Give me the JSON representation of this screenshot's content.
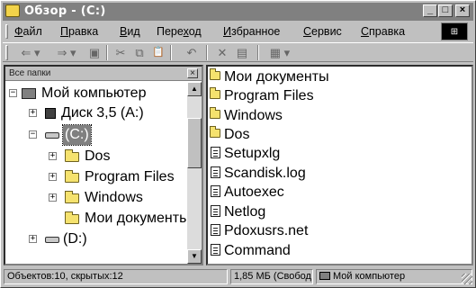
{
  "window": {
    "title": "Обзор - (C:)"
  },
  "title_buttons": {
    "minimize": "_",
    "maximize": "□",
    "close": "×"
  },
  "menu": [
    "Файл",
    "Правка",
    "Вид",
    "Переход",
    "Избранное",
    "Сервис",
    "Справка"
  ],
  "menu_accel": [
    "Ф",
    "П",
    "В",
    "х",
    "И",
    "С",
    "С"
  ],
  "toolbar": {
    "back": "⇐ ▾",
    "forward": "⇒ ▾",
    "up": "▣",
    "cut": "✂",
    "copy": "⧉",
    "paste": "📋",
    "undo": "↶",
    "delete": "✕",
    "properties": "▤",
    "views": "▦ ▾"
  },
  "left_pane": {
    "header": "Все папки",
    "close": "×",
    "tree": [
      {
        "label": "Мой компьютер",
        "icon": "computer-icon",
        "expander": "−"
      },
      {
        "label": "Диск 3,5 (A:)",
        "icon": "floppy-icon",
        "expander": "+"
      },
      {
        "label": "(C:)",
        "icon": "drive-icon",
        "expander": "−",
        "selected": true
      },
      {
        "label": "Dos",
        "icon": "folder-icon",
        "expander": "+"
      },
      {
        "label": "Program Files",
        "icon": "folder-icon",
        "expander": "+"
      },
      {
        "label": "Windows",
        "icon": "folder-icon",
        "expander": "+"
      },
      {
        "label": "Мои документы",
        "icon": "folder-icon",
        "expander": ""
      },
      {
        "label": "(D:)",
        "icon": "drive-icon",
        "expander": "+"
      }
    ]
  },
  "right_pane": {
    "items": [
      {
        "label": "Мои документы",
        "icon": "folder-icon"
      },
      {
        "label": "Program Files",
        "icon": "folder-icon"
      },
      {
        "label": "Windows",
        "icon": "folder-icon"
      },
      {
        "label": "Dos",
        "icon": "folder-icon"
      },
      {
        "label": "Setupxlg",
        "icon": "file-icon"
      },
      {
        "label": "Scandisk.log",
        "icon": "file-icon"
      },
      {
        "label": "Autoexec",
        "icon": "file-icon"
      },
      {
        "label": "Netlog",
        "icon": "file-icon"
      },
      {
        "label": "Pdoxusrs.net",
        "icon": "file-icon"
      },
      {
        "label": "Command",
        "icon": "file-icon"
      }
    ]
  },
  "status": {
    "objects": "Объектов:10, скрытых:12",
    "size": "1,85 МБ (Свобод",
    "location": "Мой компьютер"
  }
}
